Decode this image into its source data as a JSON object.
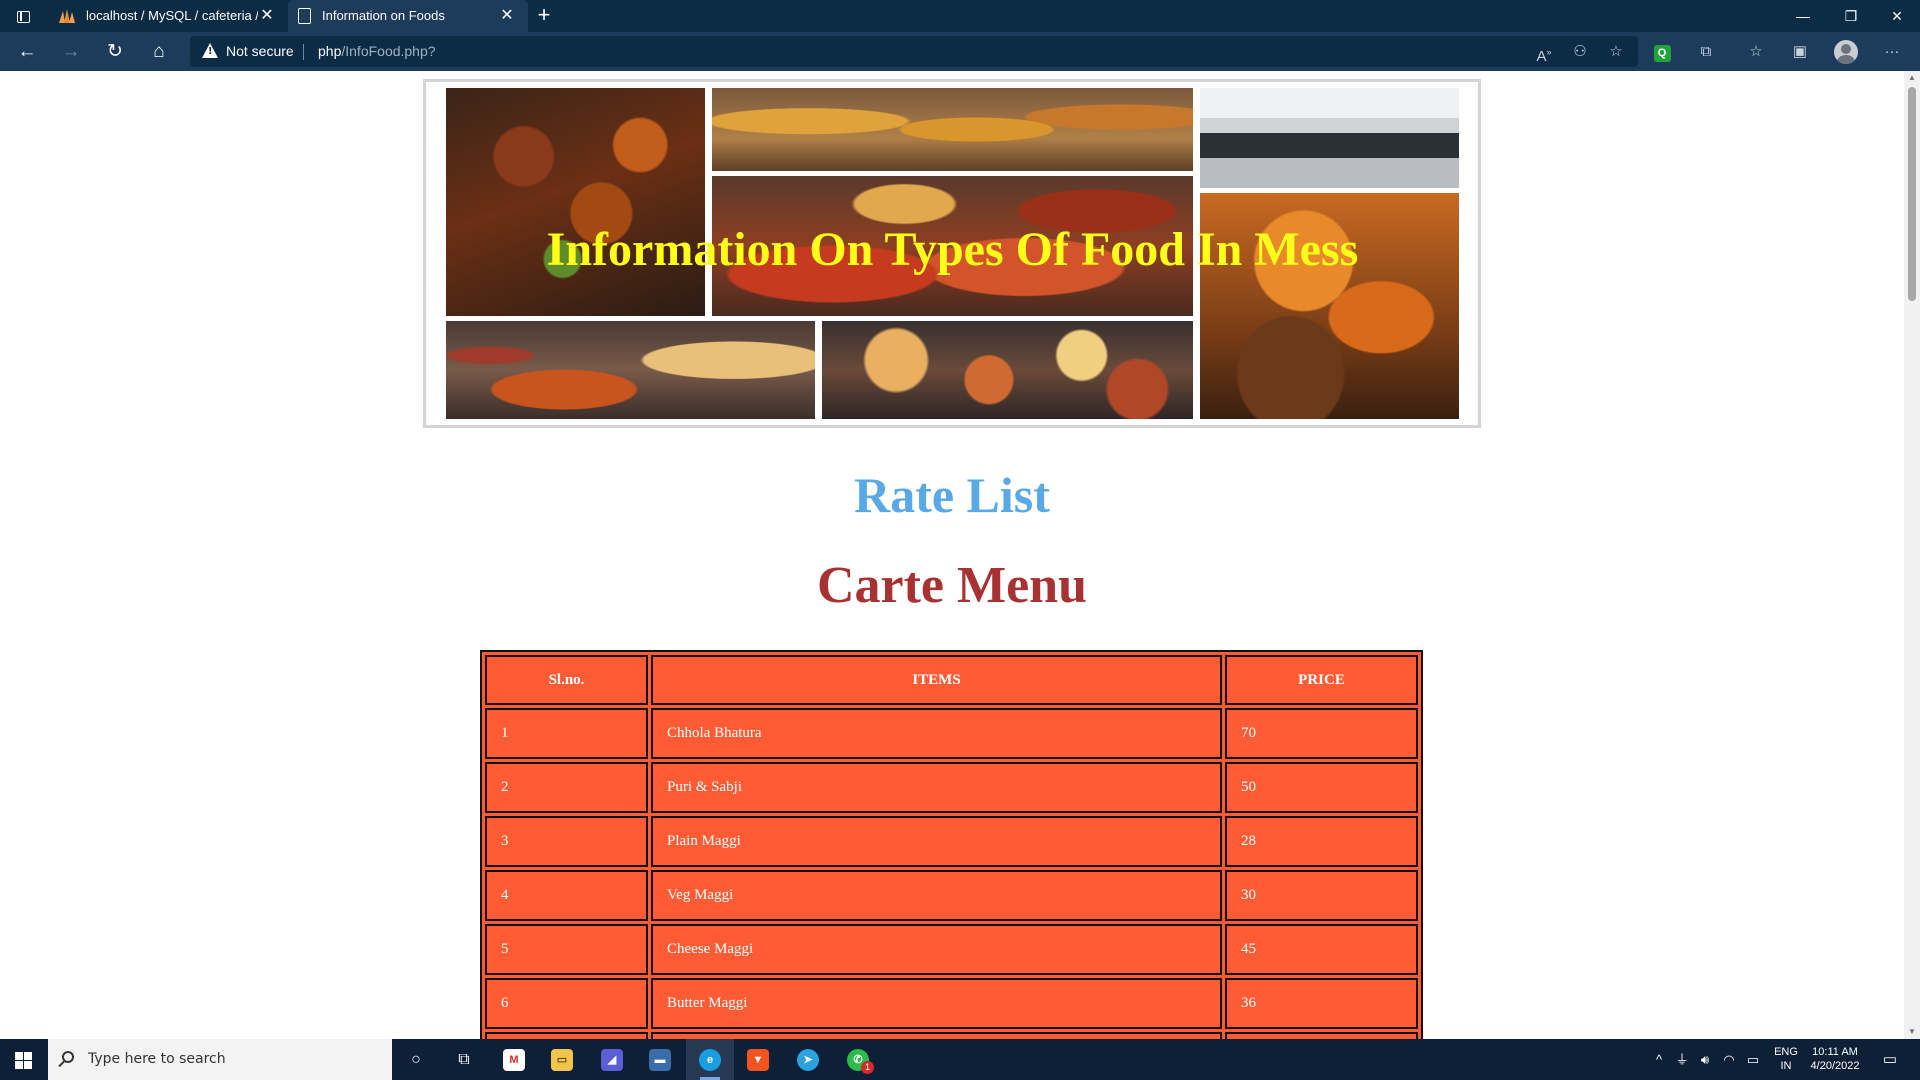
{
  "browser": {
    "tabs": [
      {
        "title": "localhost / MySQL / cafeteria / r",
        "icon": "phpmyadmin-icon"
      },
      {
        "title": "Information on Foods",
        "icon": "page-icon"
      }
    ],
    "security_label": "Not secure",
    "url_host": "php",
    "url_path": "/InfoFood.php?"
  },
  "page": {
    "banner_title": "Information On Types Of Food In Mess",
    "rate_list": "Rate List",
    "carte_menu": "Carte Menu",
    "table": {
      "headers": [
        "Sl.no.",
        "ITEMS",
        "PRICE"
      ],
      "rows": [
        [
          "1",
          "Chhola Bhatura",
          "70"
        ],
        [
          "2",
          "Puri & Sabji",
          "50"
        ],
        [
          "3",
          "Plain Maggi",
          "28"
        ],
        [
          "4",
          "Veg Maggi",
          "30"
        ],
        [
          "5",
          "Cheese Maggi",
          "45"
        ],
        [
          "6",
          "Butter Maggi",
          "36"
        ]
      ]
    },
    "colors": {
      "banner_title": "#ffff1a",
      "rate_list": "#59a9e6",
      "carte_menu": "#a83232",
      "table_bg": "#ff5c35"
    }
  },
  "taskbar": {
    "search_placeholder": "Type here to search",
    "lang_line1": "ENG",
    "lang_line2": "IN",
    "time": "10:11 AM",
    "date": "4/20/2022",
    "whatsapp_badge": "1"
  }
}
